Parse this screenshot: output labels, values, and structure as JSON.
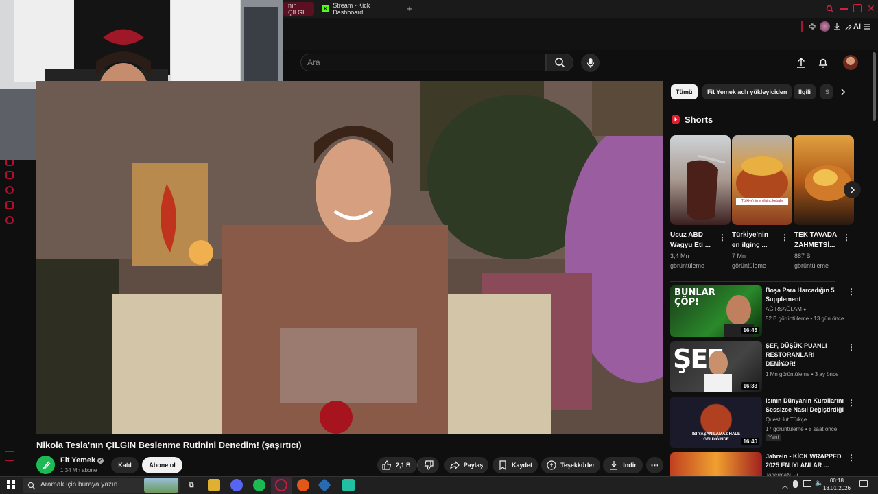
{
  "browser": {
    "tabs": [
      {
        "label": "nın ÇILGI"
      },
      {
        "label": "Stream - Kick Dashboard"
      }
    ],
    "toolbar_ai_label": "AI"
  },
  "youtube": {
    "search": {
      "placeholder": "Ara",
      "value": ""
    },
    "video": {
      "title": "Nikola Tesla'nın ÇILGIN Beslenme Rutinini Denedim! (şaşırtıcı)",
      "channel": "Fit Yemek",
      "subscribers": "1,34 Mn abone",
      "join_label": "Katıl",
      "subscribe_label": "Abone ol",
      "like_count": "2,1 B",
      "share_label": "Paylaş",
      "save_label": "Kaydet",
      "thanks_label": "Teşekkürler",
      "download_label": "İndir"
    },
    "chips": [
      "Tümü",
      "Fit Yemek adlı yükleyiciden",
      "İlgili",
      "S"
    ],
    "shorts": {
      "heading": "Shorts",
      "items": [
        {
          "title_line1": "Ucuz ABD",
          "title_line2": "Wagyu Eti ...",
          "views_line1": "3,4 Mn",
          "views_line2": "görüntüleme"
        },
        {
          "title_line1": "Türkiye'nin",
          "title_line2": "en ilginç ...",
          "views_line1": "7 Mn",
          "views_line2": "görüntüleme",
          "caption": "Türkiye'nin en ilginç kebabı"
        },
        {
          "title_line1": "TEK TAVADA",
          "title_line2": "ZAHMETSİ...",
          "views_line1": "887 B",
          "views_line2": "görüntüleme"
        }
      ]
    },
    "recommended": [
      {
        "title_line1": "Boşa Para Harcadığın 5",
        "title_line2": "Supplement",
        "channel": "AĞIRSAĞLAM",
        "meta": "52 B görüntüleme • 13 gün önce",
        "duration": "16:45",
        "thumb_text": "BUNLAR ÇÖP!"
      },
      {
        "title_line1": "ŞEF, DÜŞÜK PUANLI",
        "title_line2": "RESTORANLARI DENİYOR!",
        "channel": "Literat",
        "meta": "1 Mn görüntüleme • 3 ay önce",
        "duration": "16:33",
        "thumb_text": "ŞEF"
      },
      {
        "title_line1": "Isının Dünyanın Kurallarını",
        "title_line2": "Sessizce Nasıl Değiştirdiği",
        "channel": "QuestHut Türkçe",
        "meta": "17 görüntüleme • 8 saat önce",
        "badge": "Yeni",
        "duration": "16:40",
        "thumb_text": "ISI YAŞANILAMAZ HALE GELDİĞİNDE"
      },
      {
        "title_line1": "Jahrein - KİCK WRAPPED",
        "title_line2": "2025 EN İYİ ANLAR ...",
        "channel": "JagermaN_Jr"
      }
    ]
  },
  "taskbar": {
    "search_placeholder": "Aramak için buraya yazın",
    "time": "00:18",
    "date": "18.01.2026"
  },
  "colors": {
    "background": "#0f0f0f",
    "accent_red": "#b01030",
    "kick_green": "#53fc18",
    "chip_active": "#f1f1f1"
  }
}
